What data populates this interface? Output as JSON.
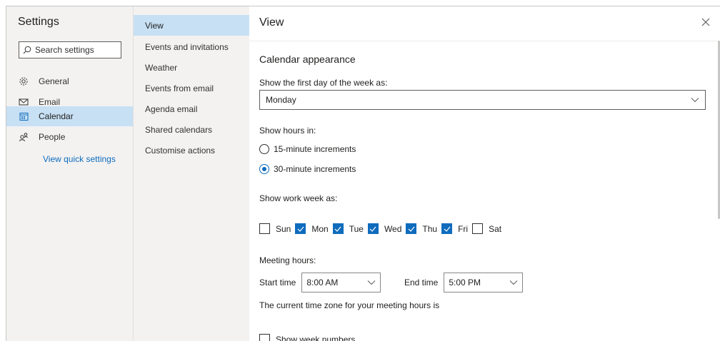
{
  "nav": {
    "title": "Settings",
    "search_placeholder": "Search settings",
    "items": [
      {
        "label": "General",
        "icon": "gear-icon"
      },
      {
        "label": "Email",
        "icon": "mail-icon"
      },
      {
        "label": "Calendar",
        "icon": "calendar-icon"
      },
      {
        "label": "People",
        "icon": "people-icon"
      }
    ],
    "quick_settings": "View quick settings"
  },
  "subnav": {
    "items": [
      "View",
      "Events and invitations",
      "Weather",
      "Events from email",
      "Agenda email",
      "Shared calendars",
      "Customise actions"
    ]
  },
  "main": {
    "title": "View",
    "section_title": "Calendar appearance",
    "first_day_label": "Show the first day of the week as:",
    "first_day_value": "Monday",
    "hours_label": "Show hours in:",
    "hours_options": [
      "15-minute increments",
      "30-minute increments"
    ],
    "hours_selected_index": 1,
    "work_week_label": "Show work week as:",
    "days": [
      {
        "label": "Sun",
        "checked": false
      },
      {
        "label": "Mon",
        "checked": true
      },
      {
        "label": "Tue",
        "checked": true
      },
      {
        "label": "Wed",
        "checked": true
      },
      {
        "label": "Thu",
        "checked": true
      },
      {
        "label": "Fri",
        "checked": true
      },
      {
        "label": "Sat",
        "checked": false
      }
    ],
    "meeting_hours_label": "Meeting hours:",
    "start_time_label": "Start time",
    "start_time_value": "8:00 AM",
    "end_time_label": "End time",
    "end_time_value": "5:00 PM",
    "timezone_text": "The current time zone for your meeting hours is",
    "week_numbers_label": "Show week numbers"
  },
  "colors": {
    "accent": "#0f6cbd",
    "selected_bg": "#c7e0f4",
    "nav_bg": "#f3f2f1"
  }
}
